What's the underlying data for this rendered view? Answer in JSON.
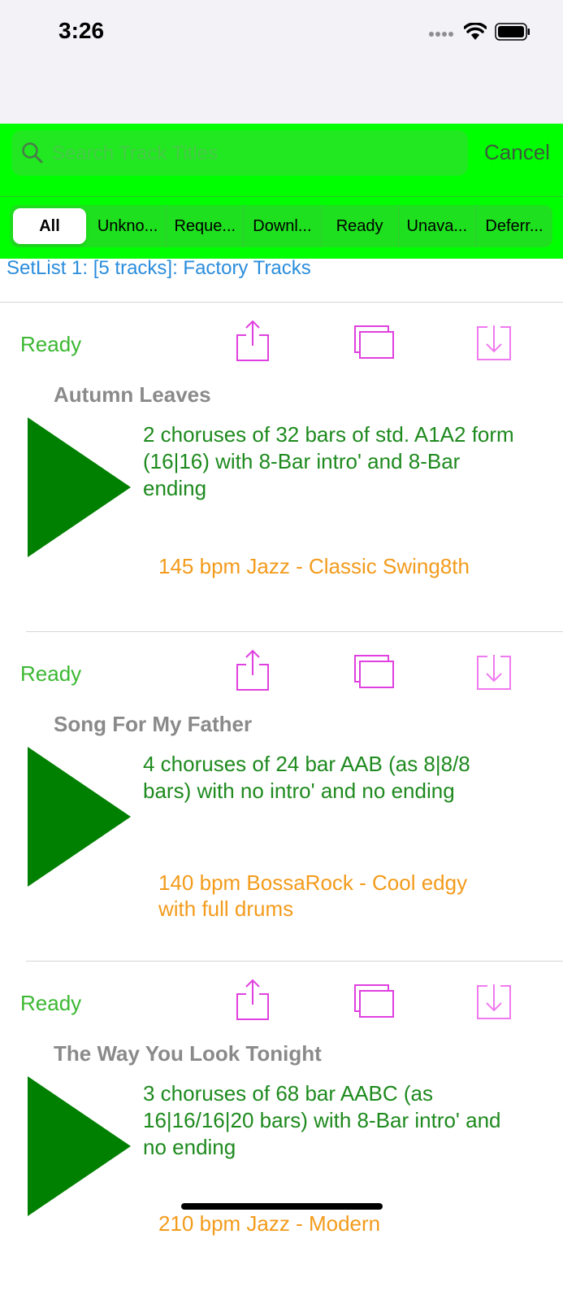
{
  "status_bar": {
    "time": "3:26",
    "icons": [
      "signal-icon",
      "wifi-icon",
      "battery-icon"
    ]
  },
  "search": {
    "placeholder": "Search Track Titles",
    "value": "",
    "cancel_label": "Cancel"
  },
  "filter": {
    "segments": [
      "All",
      "Unkno...",
      "Reque...",
      "Downl...",
      "Ready",
      "Unava...",
      "Deferr..."
    ],
    "selected": "All"
  },
  "setlist_header": "SetList 1: [5 tracks]: Factory Tracks",
  "colors": {
    "search_bg": "#00ff00",
    "status_ready": "#3cb832",
    "description": "#1e8a1e",
    "style": "#f39b1b",
    "icons": "#e040e0",
    "play": "#008000",
    "setlist": "#2a8ddc"
  },
  "action_icons": [
    "share-icon",
    "duplicate-icon",
    "download-icon"
  ],
  "tracks": [
    {
      "status": "Ready",
      "title": "Autumn Leaves",
      "description": "2 choruses of 32 bars of std. A1A2 form (16|16) with 8-Bar intro' and 8-Bar ending",
      "style": "145 bpm Jazz - Classic Swing8th"
    },
    {
      "status": "Ready",
      "title": "Song For My Father",
      "description": "4 choruses of 24 bar AAB (as 8|8/8 bars) with no intro' and no ending",
      "style": "140 bpm BossaRock - Cool edgy with full drums"
    },
    {
      "status": "Ready",
      "title": "The Way You Look Tonight",
      "description": "3 choruses of 68 bar AABC (as 16|16/16|20 bars) with 8-Bar intro' and no ending",
      "style": "210 bpm Jazz - Modern"
    }
  ]
}
